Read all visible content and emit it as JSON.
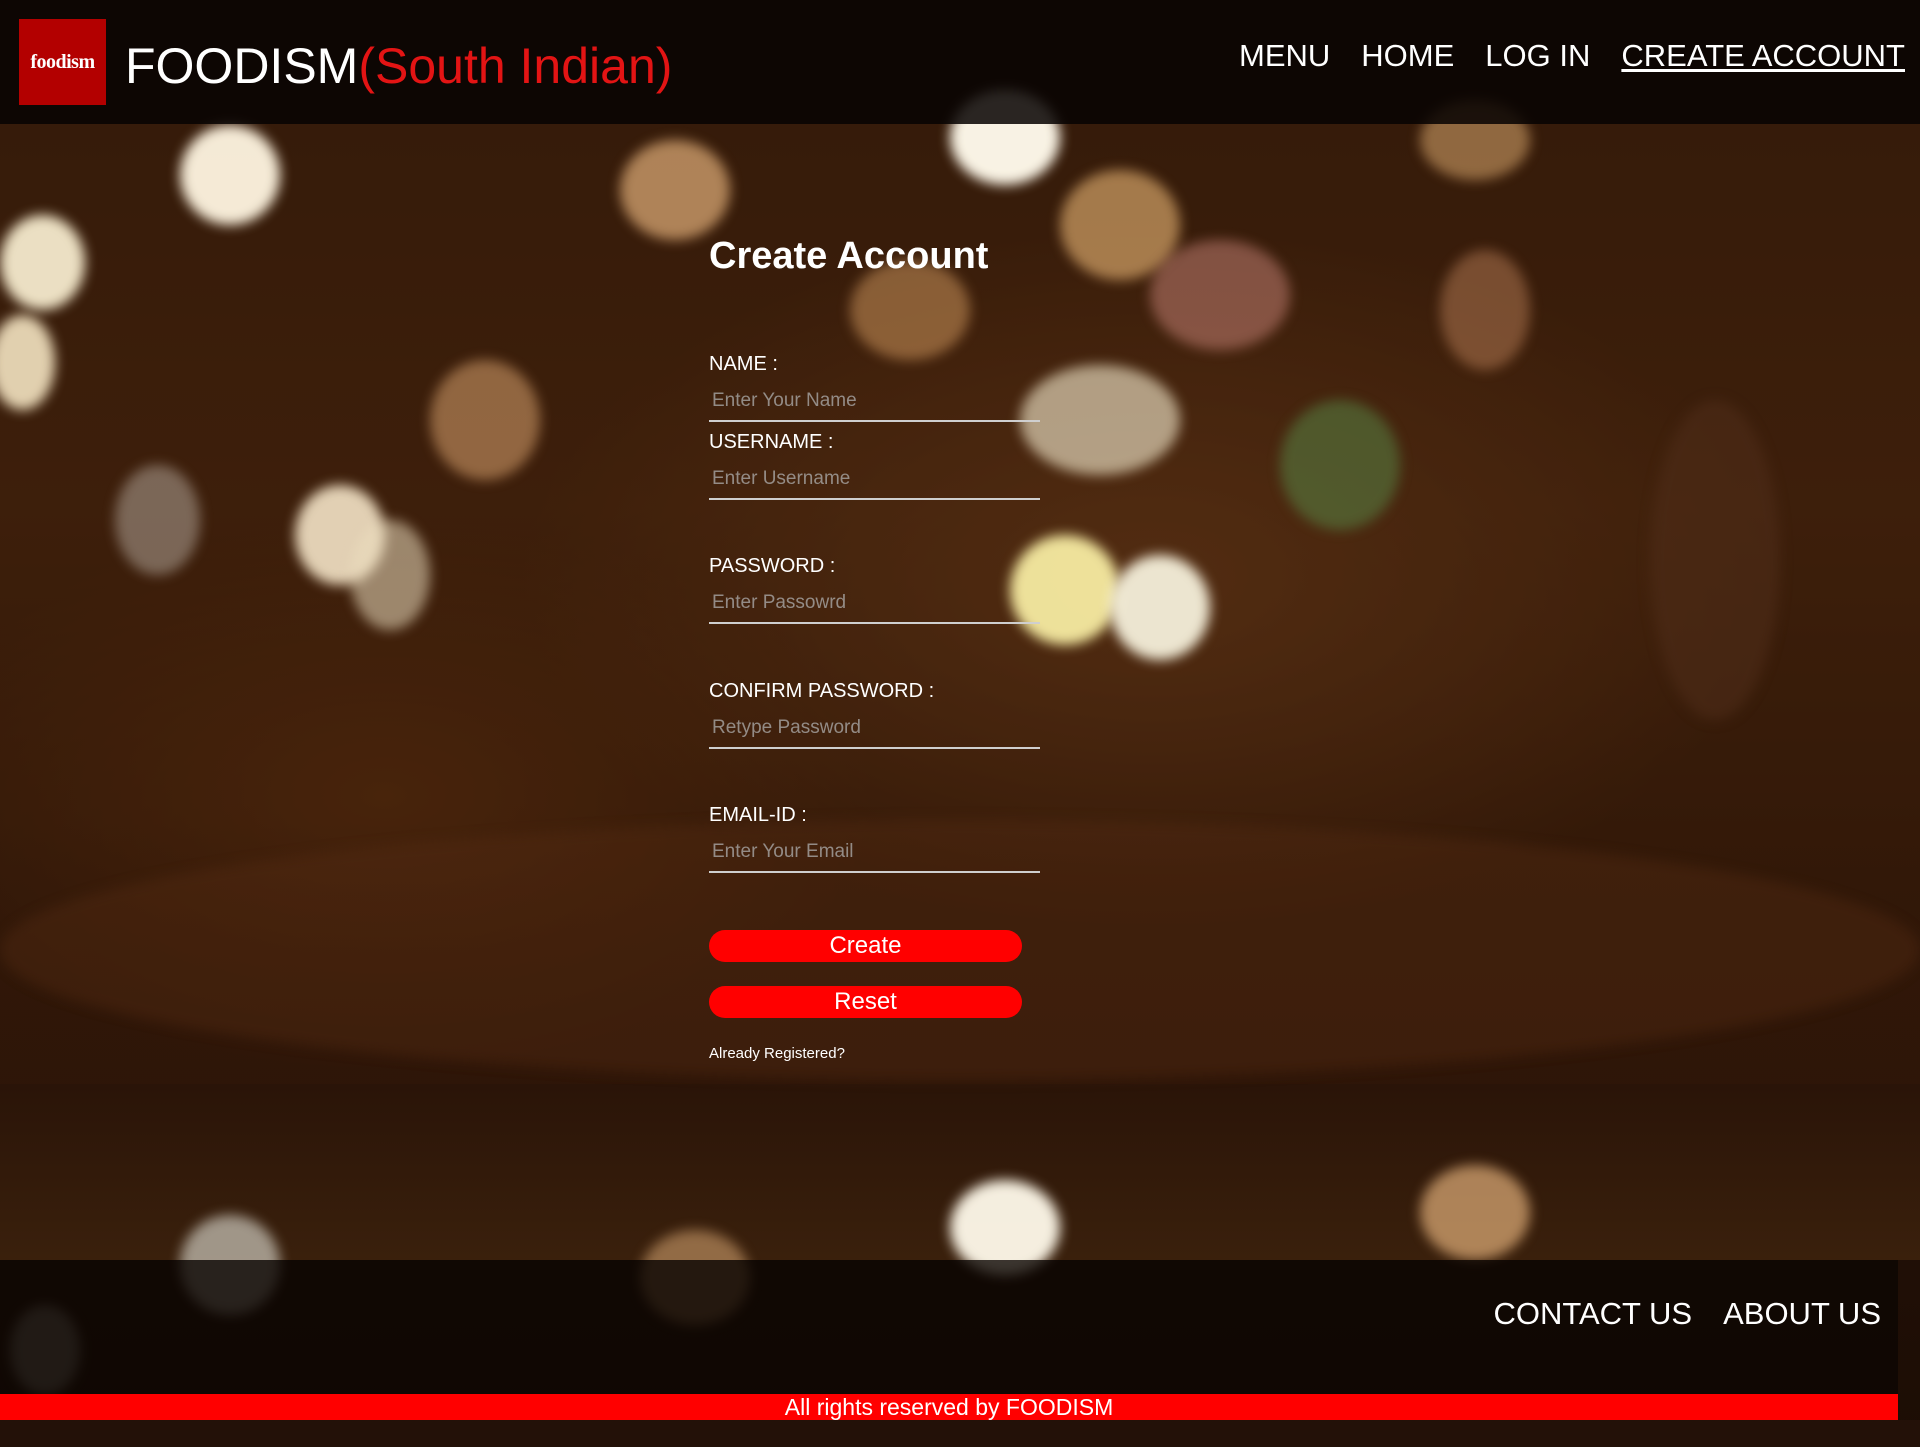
{
  "header": {
    "logo_text": "foodism",
    "brand_main": "FOODISM",
    "brand_sub": "(South Indian)",
    "nav": [
      {
        "label": "MENU",
        "active": false
      },
      {
        "label": "HOME",
        "active": false
      },
      {
        "label": "LOG IN",
        "active": false
      },
      {
        "label": "CREATE ACCOUNT",
        "active": true
      }
    ]
  },
  "form": {
    "title": "Create Account",
    "fields": [
      {
        "label": "NAME :",
        "placeholder": "Enter Your Name",
        "value": ""
      },
      {
        "label": "USERNAME :",
        "placeholder": "Enter Username",
        "value": ""
      },
      {
        "label": "PASSWORD :",
        "placeholder": "Enter Passowrd",
        "value": ""
      },
      {
        "label": "CONFIRM PASSWORD :",
        "placeholder": "Retype Password",
        "value": ""
      },
      {
        "label": "EMAIL-ID :",
        "placeholder": "Enter Your Email",
        "value": ""
      }
    ],
    "create_label": "Create",
    "reset_label": "Reset",
    "already_registered": "Already Registered?"
  },
  "footer": {
    "links": [
      {
        "label": "CONTACT US"
      },
      {
        "label": "ABOUT US"
      }
    ],
    "copyright": "All rights reserved by FOODISM"
  },
  "colors": {
    "accent_red": "#ff0000",
    "brand_sub_red": "#e31414",
    "logo_red": "#b30000"
  }
}
